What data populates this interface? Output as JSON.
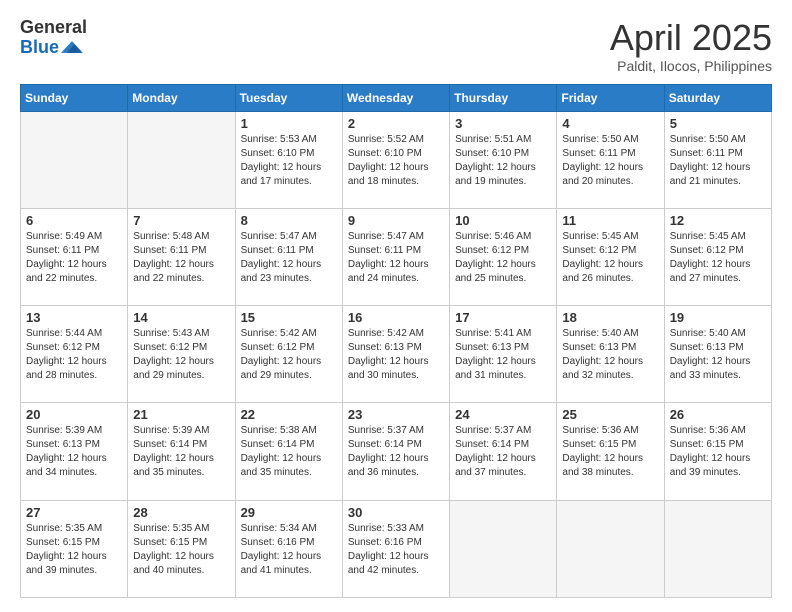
{
  "logo": {
    "general": "General",
    "blue": "Blue"
  },
  "title": {
    "month": "April 2025",
    "location": "Paldit, Ilocos, Philippines"
  },
  "weekdays": [
    "Sunday",
    "Monday",
    "Tuesday",
    "Wednesday",
    "Thursday",
    "Friday",
    "Saturday"
  ],
  "weeks": [
    [
      {
        "day": null,
        "sunrise": null,
        "sunset": null,
        "daylight": null
      },
      {
        "day": null,
        "sunrise": null,
        "sunset": null,
        "daylight": null
      },
      {
        "day": 1,
        "sunrise": "Sunrise: 5:53 AM",
        "sunset": "Sunset: 6:10 PM",
        "daylight": "Daylight: 12 hours and 17 minutes."
      },
      {
        "day": 2,
        "sunrise": "Sunrise: 5:52 AM",
        "sunset": "Sunset: 6:10 PM",
        "daylight": "Daylight: 12 hours and 18 minutes."
      },
      {
        "day": 3,
        "sunrise": "Sunrise: 5:51 AM",
        "sunset": "Sunset: 6:10 PM",
        "daylight": "Daylight: 12 hours and 19 minutes."
      },
      {
        "day": 4,
        "sunrise": "Sunrise: 5:50 AM",
        "sunset": "Sunset: 6:11 PM",
        "daylight": "Daylight: 12 hours and 20 minutes."
      },
      {
        "day": 5,
        "sunrise": "Sunrise: 5:50 AM",
        "sunset": "Sunset: 6:11 PM",
        "daylight": "Daylight: 12 hours and 21 minutes."
      }
    ],
    [
      {
        "day": 6,
        "sunrise": "Sunrise: 5:49 AM",
        "sunset": "Sunset: 6:11 PM",
        "daylight": "Daylight: 12 hours and 22 minutes."
      },
      {
        "day": 7,
        "sunrise": "Sunrise: 5:48 AM",
        "sunset": "Sunset: 6:11 PM",
        "daylight": "Daylight: 12 hours and 22 minutes."
      },
      {
        "day": 8,
        "sunrise": "Sunrise: 5:47 AM",
        "sunset": "Sunset: 6:11 PM",
        "daylight": "Daylight: 12 hours and 23 minutes."
      },
      {
        "day": 9,
        "sunrise": "Sunrise: 5:47 AM",
        "sunset": "Sunset: 6:11 PM",
        "daylight": "Daylight: 12 hours and 24 minutes."
      },
      {
        "day": 10,
        "sunrise": "Sunrise: 5:46 AM",
        "sunset": "Sunset: 6:12 PM",
        "daylight": "Daylight: 12 hours and 25 minutes."
      },
      {
        "day": 11,
        "sunrise": "Sunrise: 5:45 AM",
        "sunset": "Sunset: 6:12 PM",
        "daylight": "Daylight: 12 hours and 26 minutes."
      },
      {
        "day": 12,
        "sunrise": "Sunrise: 5:45 AM",
        "sunset": "Sunset: 6:12 PM",
        "daylight": "Daylight: 12 hours and 27 minutes."
      }
    ],
    [
      {
        "day": 13,
        "sunrise": "Sunrise: 5:44 AM",
        "sunset": "Sunset: 6:12 PM",
        "daylight": "Daylight: 12 hours and 28 minutes."
      },
      {
        "day": 14,
        "sunrise": "Sunrise: 5:43 AM",
        "sunset": "Sunset: 6:12 PM",
        "daylight": "Daylight: 12 hours and 29 minutes."
      },
      {
        "day": 15,
        "sunrise": "Sunrise: 5:42 AM",
        "sunset": "Sunset: 6:12 PM",
        "daylight": "Daylight: 12 hours and 29 minutes."
      },
      {
        "day": 16,
        "sunrise": "Sunrise: 5:42 AM",
        "sunset": "Sunset: 6:13 PM",
        "daylight": "Daylight: 12 hours and 30 minutes."
      },
      {
        "day": 17,
        "sunrise": "Sunrise: 5:41 AM",
        "sunset": "Sunset: 6:13 PM",
        "daylight": "Daylight: 12 hours and 31 minutes."
      },
      {
        "day": 18,
        "sunrise": "Sunrise: 5:40 AM",
        "sunset": "Sunset: 6:13 PM",
        "daylight": "Daylight: 12 hours and 32 minutes."
      },
      {
        "day": 19,
        "sunrise": "Sunrise: 5:40 AM",
        "sunset": "Sunset: 6:13 PM",
        "daylight": "Daylight: 12 hours and 33 minutes."
      }
    ],
    [
      {
        "day": 20,
        "sunrise": "Sunrise: 5:39 AM",
        "sunset": "Sunset: 6:13 PM",
        "daylight": "Daylight: 12 hours and 34 minutes."
      },
      {
        "day": 21,
        "sunrise": "Sunrise: 5:39 AM",
        "sunset": "Sunset: 6:14 PM",
        "daylight": "Daylight: 12 hours and 35 minutes."
      },
      {
        "day": 22,
        "sunrise": "Sunrise: 5:38 AM",
        "sunset": "Sunset: 6:14 PM",
        "daylight": "Daylight: 12 hours and 35 minutes."
      },
      {
        "day": 23,
        "sunrise": "Sunrise: 5:37 AM",
        "sunset": "Sunset: 6:14 PM",
        "daylight": "Daylight: 12 hours and 36 minutes."
      },
      {
        "day": 24,
        "sunrise": "Sunrise: 5:37 AM",
        "sunset": "Sunset: 6:14 PM",
        "daylight": "Daylight: 12 hours and 37 minutes."
      },
      {
        "day": 25,
        "sunrise": "Sunrise: 5:36 AM",
        "sunset": "Sunset: 6:15 PM",
        "daylight": "Daylight: 12 hours and 38 minutes."
      },
      {
        "day": 26,
        "sunrise": "Sunrise: 5:36 AM",
        "sunset": "Sunset: 6:15 PM",
        "daylight": "Daylight: 12 hours and 39 minutes."
      }
    ],
    [
      {
        "day": 27,
        "sunrise": "Sunrise: 5:35 AM",
        "sunset": "Sunset: 6:15 PM",
        "daylight": "Daylight: 12 hours and 39 minutes."
      },
      {
        "day": 28,
        "sunrise": "Sunrise: 5:35 AM",
        "sunset": "Sunset: 6:15 PM",
        "daylight": "Daylight: 12 hours and 40 minutes."
      },
      {
        "day": 29,
        "sunrise": "Sunrise: 5:34 AM",
        "sunset": "Sunset: 6:16 PM",
        "daylight": "Daylight: 12 hours and 41 minutes."
      },
      {
        "day": 30,
        "sunrise": "Sunrise: 5:33 AM",
        "sunset": "Sunset: 6:16 PM",
        "daylight": "Daylight: 12 hours and 42 minutes."
      },
      {
        "day": null,
        "sunrise": null,
        "sunset": null,
        "daylight": null
      },
      {
        "day": null,
        "sunrise": null,
        "sunset": null,
        "daylight": null
      },
      {
        "day": null,
        "sunrise": null,
        "sunset": null,
        "daylight": null
      }
    ]
  ]
}
